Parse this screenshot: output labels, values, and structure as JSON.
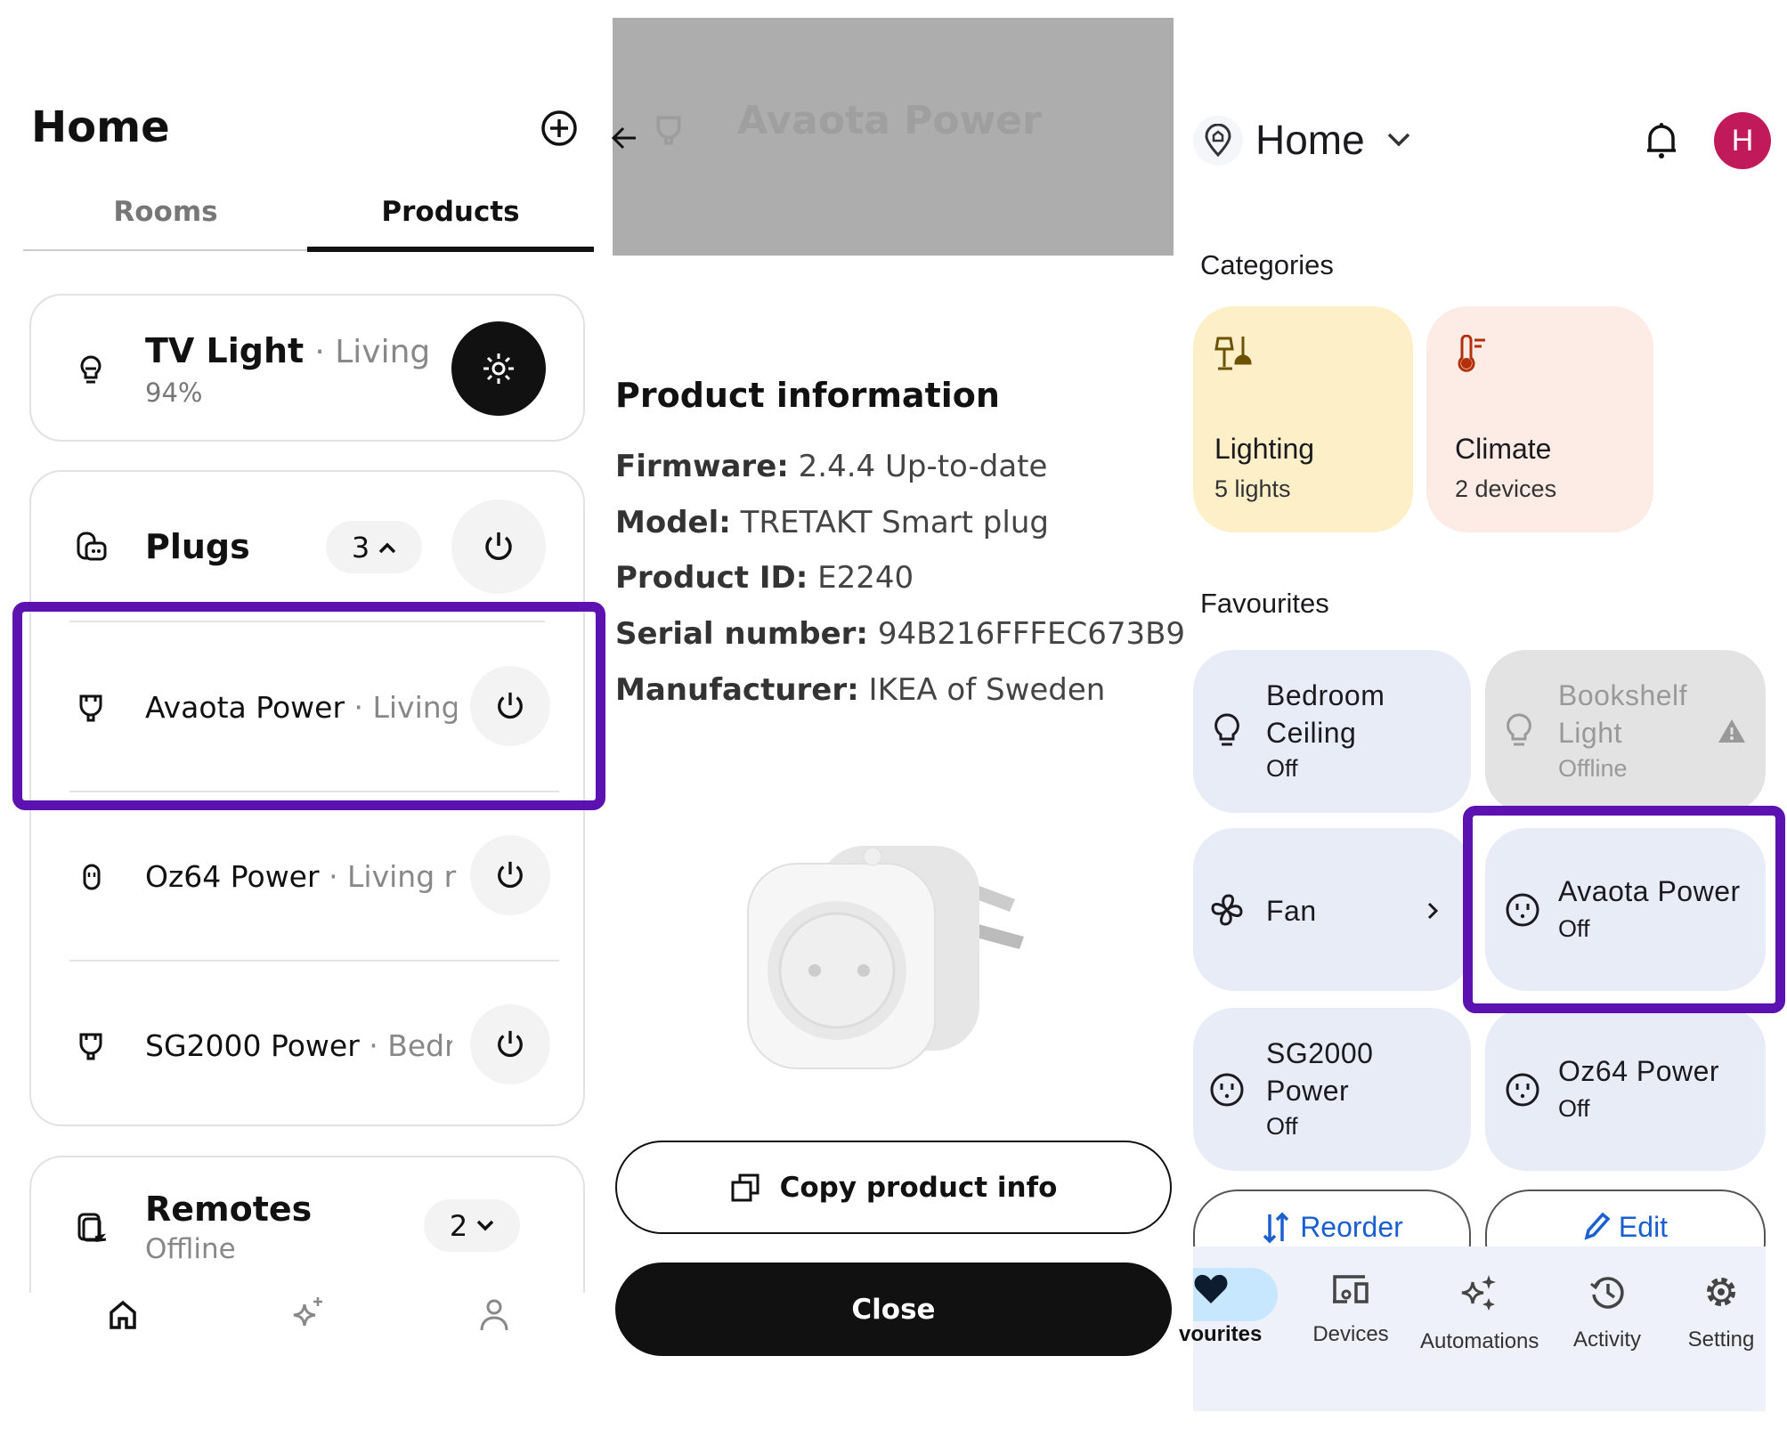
{
  "left": {
    "title": "Home",
    "tabs": [
      {
        "label": "Rooms",
        "active": false
      },
      {
        "label": "Products",
        "active": true
      }
    ],
    "tv_light": {
      "name": "TV Light",
      "location": "· Living r",
      "status": "94%"
    },
    "plugs": {
      "title": "Plugs",
      "count": "3",
      "items": [
        {
          "name": "Avaota Power",
          "location": "· Living"
        },
        {
          "name": "Oz64 Power",
          "location": "· Living r"
        },
        {
          "name": "SG2000 Power",
          "location": "· Bedr"
        }
      ]
    },
    "remotes": {
      "title": "Remotes",
      "status": "Offline",
      "count": "2"
    },
    "nav": [
      "home-icon",
      "sparkle-icon",
      "person-icon"
    ]
  },
  "middle": {
    "header_title": "Avaota Power",
    "section_title": "Product information",
    "info": [
      {
        "label": "Firmware:",
        "value": "2.4.4 Up-to-date"
      },
      {
        "label": "Model:",
        "value": "TRETAKT Smart plug"
      },
      {
        "label": "Product ID:",
        "value": "E2240"
      },
      {
        "label": "Serial number:",
        "value": "94B216FFFEC673B9"
      },
      {
        "label": "Manufacturer:",
        "value": "IKEA of Sweden"
      }
    ],
    "copy_button": "Copy product info",
    "close_button": "Close"
  },
  "right": {
    "home_label": "Home",
    "avatar_letter": "H",
    "avatar_color": "#c2185b",
    "categories_title": "Categories",
    "categories": [
      {
        "name": "Lighting",
        "sub": "5 lights",
        "color": "#fdefc7"
      },
      {
        "name": "Climate",
        "sub": "2 devices",
        "color": "#fdece6"
      }
    ],
    "favourites_title": "Favourites",
    "favourites": [
      {
        "name": "Bedroom Ceiling",
        "status": "Off"
      },
      {
        "name": "Bookshelf Light",
        "status": "Offline"
      },
      {
        "name": "Fan"
      },
      {
        "name": "Avaota Power",
        "status": "Off"
      },
      {
        "name": "SG2000 Power",
        "status": "Off"
      },
      {
        "name": "Oz64 Power",
        "status": "Off"
      }
    ],
    "reorder_label": "Reorder",
    "edit_label": "Edit",
    "nav": [
      {
        "label": "vourites",
        "active": true
      },
      {
        "label": "Devices"
      },
      {
        "label": "Automations"
      },
      {
        "label": "Activity"
      },
      {
        "label": "Setting"
      }
    ]
  },
  "highlight_color": "#5b12b0"
}
